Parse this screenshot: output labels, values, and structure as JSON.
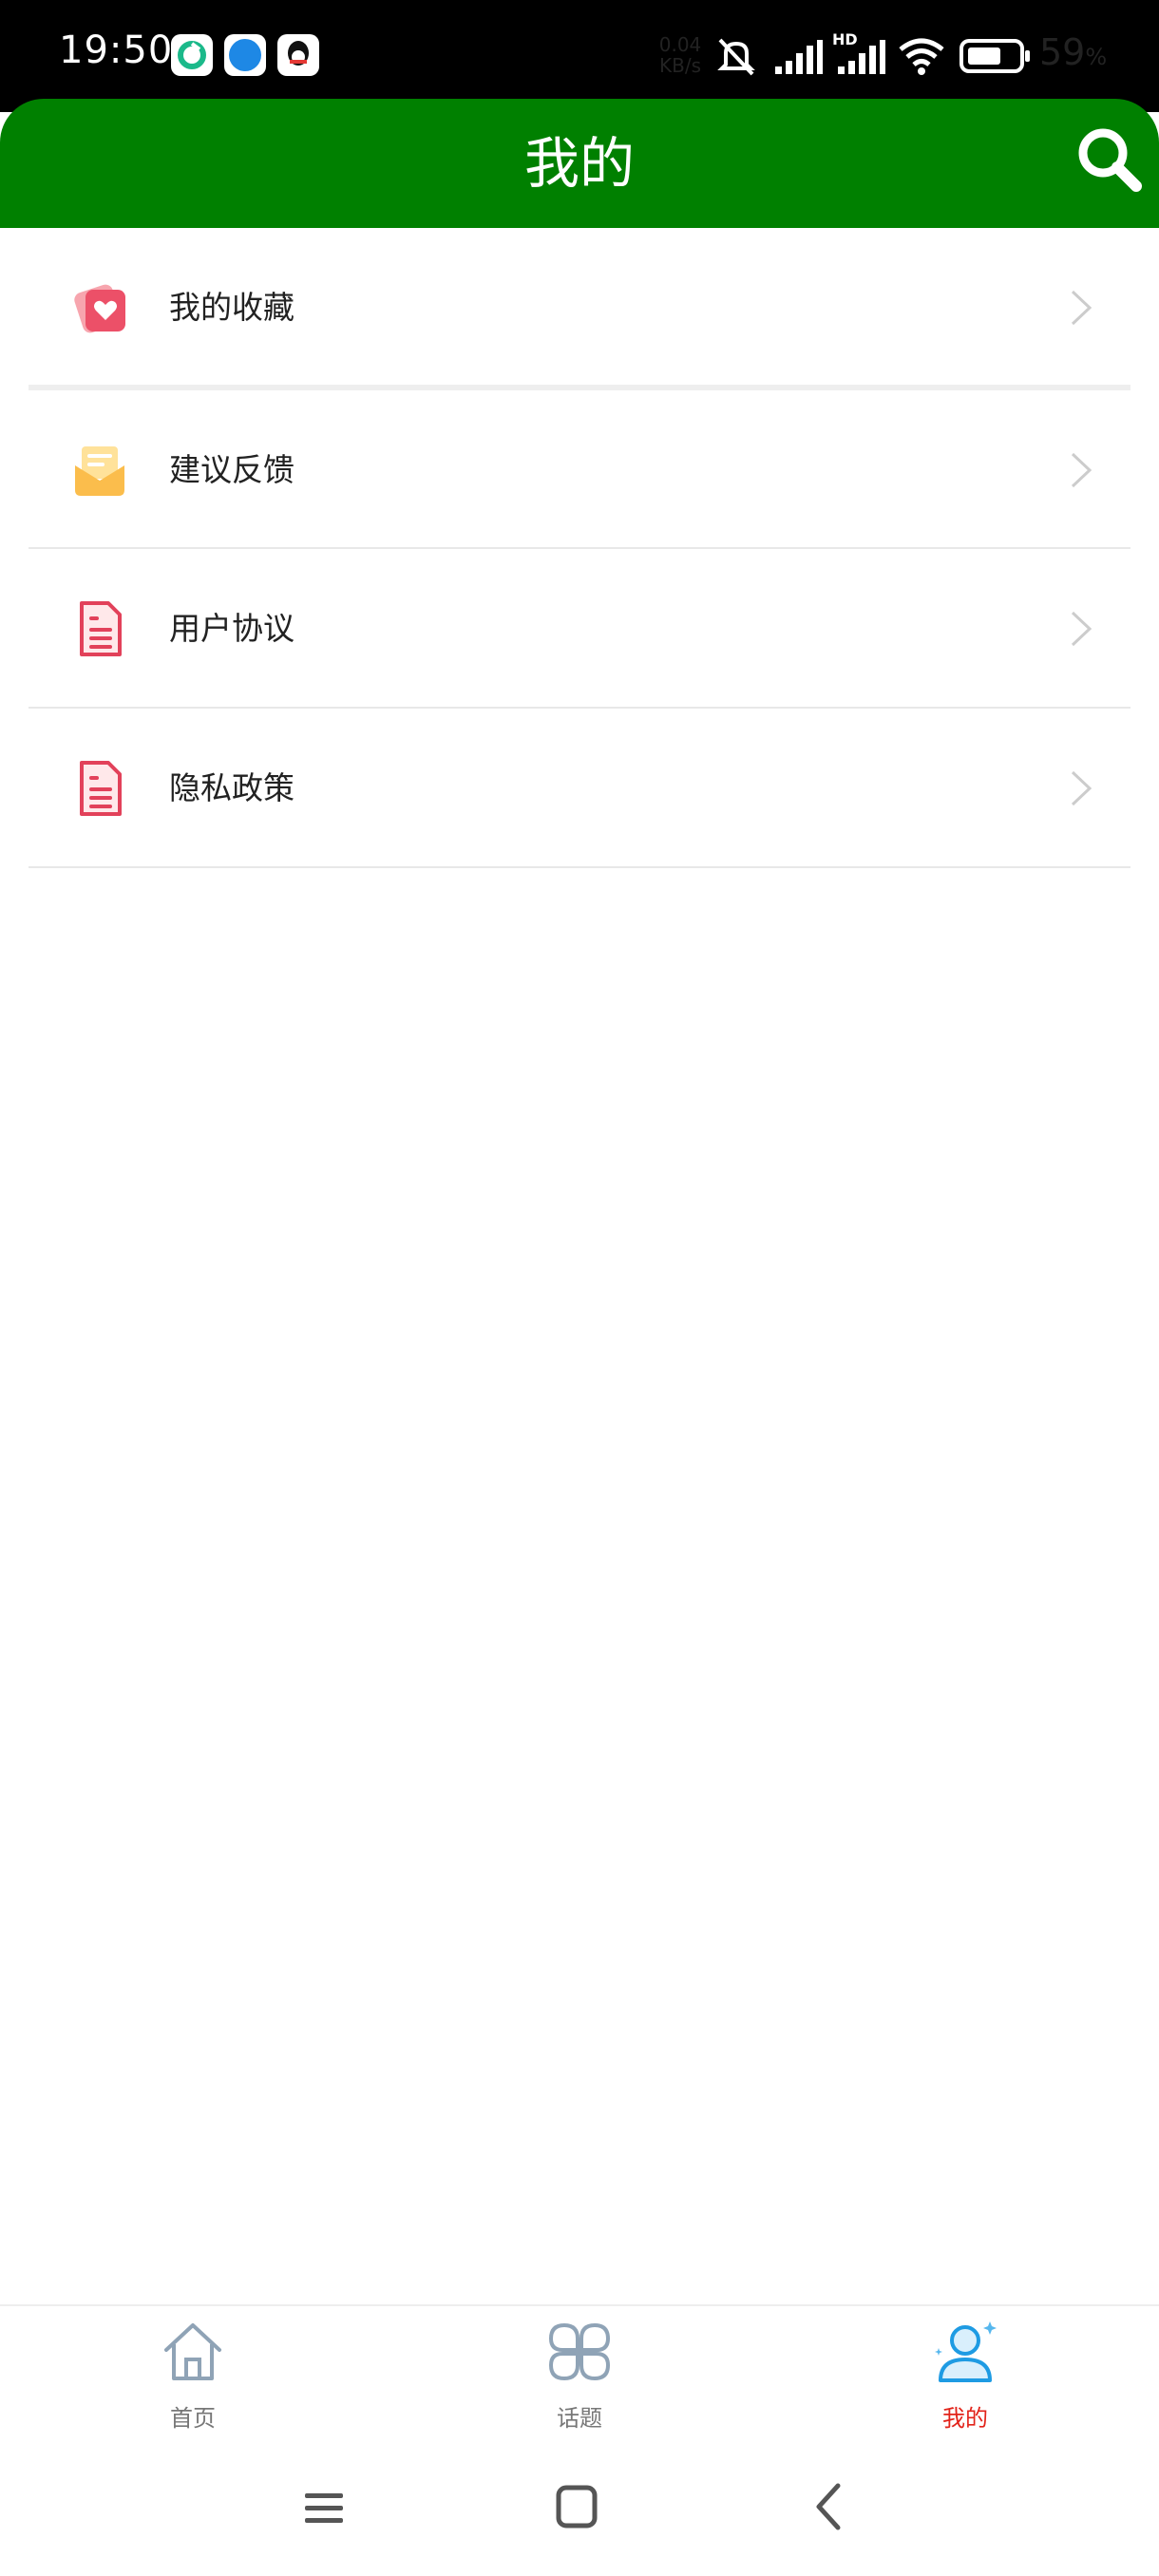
{
  "status_bar": {
    "time": "19:50",
    "speed_value": "0.04",
    "speed_unit": "KB/s",
    "network_badge": "HD",
    "battery_percent": "59",
    "battery_unit": "%",
    "icons": [
      "app-green-icon",
      "compass-app-icon",
      "qq-app-icon",
      "vibrate-mute-icon",
      "signal-icon",
      "signal-hd-icon",
      "wifi-icon",
      "battery-icon"
    ]
  },
  "header": {
    "title": "我的",
    "search_icon": "search-icon",
    "color": "#008000"
  },
  "menu": {
    "items": [
      {
        "label": "我的收藏",
        "icon": "favorites-icon"
      },
      {
        "label": "建议反馈",
        "icon": "feedback-mail-icon"
      },
      {
        "label": "用户协议",
        "icon": "document-icon"
      },
      {
        "label": "隐私政策",
        "icon": "document-icon"
      }
    ]
  },
  "tabbar": {
    "tabs": [
      {
        "label": "首页",
        "icon": "home-icon",
        "active": false
      },
      {
        "label": "话题",
        "icon": "topics-grid-icon",
        "active": false
      },
      {
        "label": "我的",
        "icon": "profile-icon",
        "active": true
      }
    ],
    "active_color": "#e2231a"
  },
  "navbar": {
    "buttons": [
      "menu-nav-icon",
      "home-nav-icon",
      "back-nav-icon"
    ]
  }
}
